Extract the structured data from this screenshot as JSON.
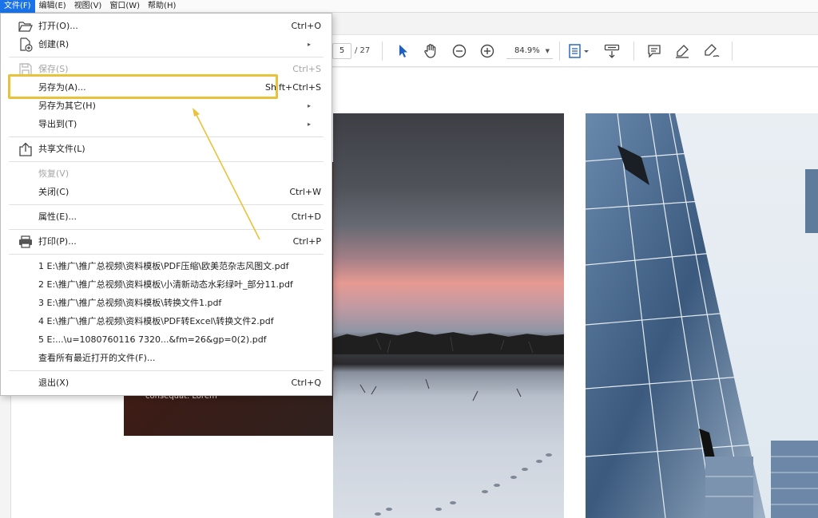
{
  "menubar": {
    "items": [
      "文件(F)",
      "编辑(E)",
      "视图(V)",
      "窗口(W)",
      "帮助(H)"
    ],
    "active_index": 0
  },
  "toolbar": {
    "page_current": "5",
    "page_total": "/ 27",
    "zoom": "84.9%",
    "icons": [
      "pointer-icon",
      "hand-icon",
      "zoom-out-icon",
      "zoom-in-icon",
      "page-fit-icon",
      "scroll-mode-icon",
      "comment-icon",
      "highlight-icon",
      "sign-icon"
    ]
  },
  "file_menu": {
    "items": [
      {
        "label": "打开(O)...",
        "shortcut": "Ctrl+O",
        "icon": "folder-open-icon"
      },
      {
        "label": "创建(R)",
        "submenu": true,
        "icon": "create-pdf-icon"
      },
      {
        "label": "保存(S)",
        "shortcut": "Ctrl+S",
        "disabled": true,
        "icon": "save-icon"
      },
      {
        "label": "另存为(A)...",
        "shortcut": "Shift+Ctrl+S"
      },
      {
        "label": "另存为其它(H)",
        "submenu": true
      },
      {
        "label": "导出到(T)",
        "submenu": true
      },
      {
        "label": "共享文件(L)",
        "icon": "share-icon"
      },
      {
        "label": "恢复(V)",
        "disabled": true
      },
      {
        "label": "关闭(C)",
        "shortcut": "Ctrl+W"
      },
      {
        "label": "属性(E)...",
        "shortcut": "Ctrl+D"
      },
      {
        "label": "打印(P)...",
        "shortcut": "Ctrl+P",
        "icon": "printer-icon"
      },
      {
        "label": "1 E:\\推广\\推广总视频\\资料模板\\PDF压缩\\欧美范杂志风图文.pdf"
      },
      {
        "label": "2 E:\\推广\\推广总视频\\资料模板\\小清新动态水彩绿叶_部分11.pdf"
      },
      {
        "label": "3 E:\\推广\\推广总视频\\资料模板\\转换文件1.pdf"
      },
      {
        "label": "4 E:\\推广\\推广总视频\\资料模板\\PDF转Excel\\转换文件2.pdf"
      },
      {
        "label": "5 E:...\\u=1080760116 7320...&fm=26&gp=0(2).pdf"
      },
      {
        "label": "查看所有最近打开的文件(F)..."
      },
      {
        "label": "退出(X)",
        "shortcut": "Ctrl+Q"
      }
    ]
  },
  "document": {
    "card_text": "consequat. Lorem"
  },
  "colors": {
    "highlight": "#e8c23a",
    "menu_active": "#1a73e8"
  }
}
